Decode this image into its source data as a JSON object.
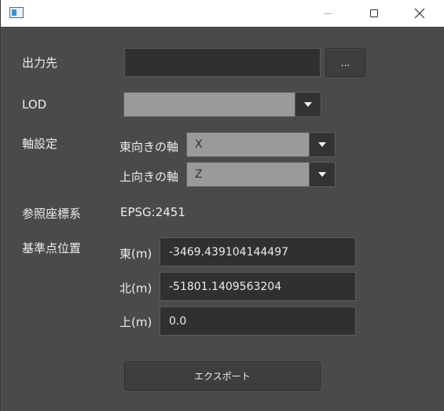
{
  "window": {
    "icons": {
      "app": "app-window-icon",
      "minimize": "minimize-icon",
      "maximize": "maximize-icon",
      "close": "close-icon"
    }
  },
  "form": {
    "output_label": "出力先",
    "output_value": "",
    "browse_label": "...",
    "lod_label": "LOD",
    "lod_value": "",
    "axis_label": "軸設定",
    "east_axis_label": "東向きの軸",
    "east_axis_value": "X",
    "up_axis_label": "上向きの軸",
    "up_axis_value": "Z",
    "crs_label": "参照座標系",
    "crs_value": "EPSG:2451",
    "origin_label": "基準点位置",
    "east_label": "東(m)",
    "east_value": "-3469.439104144497",
    "north_label": "北(m)",
    "north_value": "-51801.1409563204",
    "up_label": "上(m)",
    "up_value": "0.0",
    "export_label": "エクスポート"
  }
}
